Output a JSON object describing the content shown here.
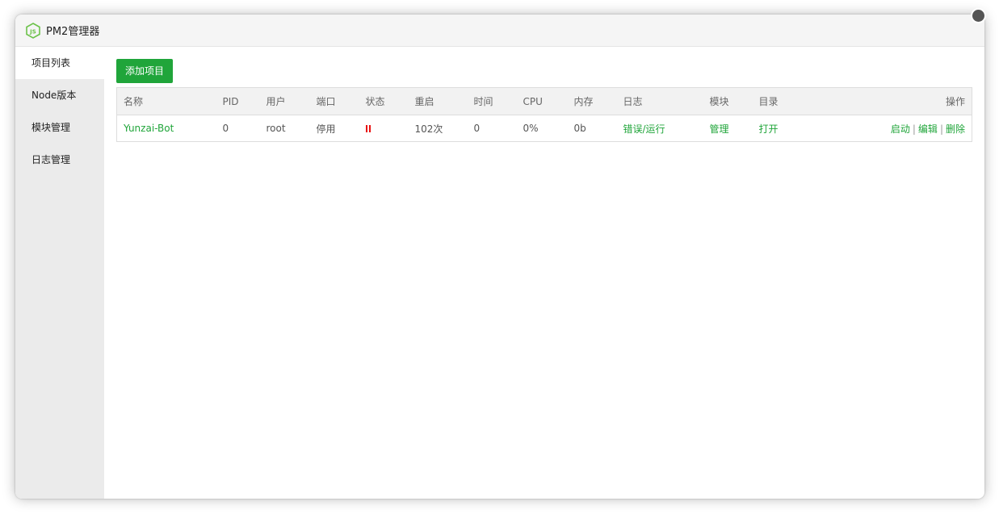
{
  "app": {
    "title": "PM2管理器",
    "icon": "nodejs-icon",
    "accent": "#20a53a"
  },
  "sidebar": {
    "items": [
      {
        "label": "项目列表",
        "active": true
      },
      {
        "label": "Node版本",
        "active": false
      },
      {
        "label": "模块管理",
        "active": false
      },
      {
        "label": "日志管理",
        "active": false
      }
    ]
  },
  "toolbar": {
    "add_label": "添加项目"
  },
  "table": {
    "headers": {
      "name": "名称",
      "pid": "PID",
      "user": "用户",
      "port": "端口",
      "status": "状态",
      "restart": "重启",
      "time": "时间",
      "cpu": "CPU",
      "memory": "内存",
      "log": "日志",
      "module": "模块",
      "dir": "目录",
      "actions": "操作"
    },
    "rows": [
      {
        "name": "Yunzai-Bot",
        "pid": "0",
        "user": "root",
        "port": "停用",
        "status_icon": "pause-icon",
        "restart": "102次",
        "time": "0",
        "cpu": "0%",
        "memory": "0b",
        "log": "错误/运行",
        "module": "管理",
        "dir": "打开",
        "action_start": "启动",
        "action_edit": "编辑",
        "action_delete": "删除",
        "separator": "|"
      }
    ]
  }
}
